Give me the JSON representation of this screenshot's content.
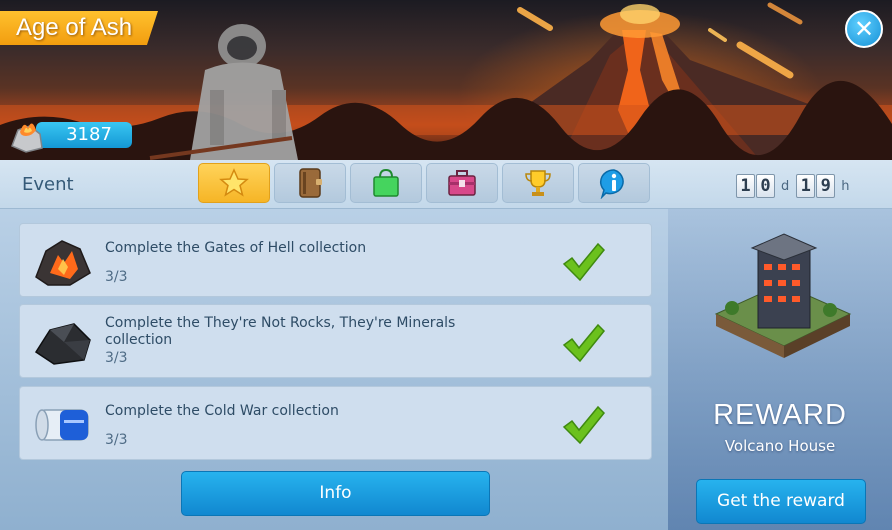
{
  "event": {
    "title": "Age of Ash",
    "currency_value": "3187",
    "close_icon": "close-icon"
  },
  "tabbar": {
    "label": "Event",
    "tabs": [
      {
        "icon": "star-icon",
        "active": true
      },
      {
        "icon": "journal-icon",
        "active": false
      },
      {
        "icon": "shopping-bag-icon",
        "active": false
      },
      {
        "icon": "toolbox-icon",
        "active": false
      },
      {
        "icon": "trophy-icon",
        "active": false
      },
      {
        "icon": "info-icon",
        "active": false
      }
    ]
  },
  "timer": {
    "days_d1": "1",
    "days_d2": "0",
    "days_unit": "d",
    "hours_d1": "1",
    "hours_d2": "9",
    "hours_unit": "h"
  },
  "tasks": [
    {
      "text": "Complete the Gates of Hell collection",
      "progress": "3/3",
      "done": true,
      "icon": "lava-rock-icon"
    },
    {
      "text": "Complete the They're Not Rocks, They're Minerals collection",
      "progress": "3/3",
      "done": true,
      "icon": "black-mineral-icon"
    },
    {
      "text": "Complete the Cold War collection",
      "progress": "3/3",
      "done": true,
      "icon": "canister-icon"
    }
  ],
  "buttons": {
    "info": "Info",
    "get_reward": "Get the reward"
  },
  "reward": {
    "heading": "REWARD",
    "name": "Volcano House",
    "icon": "volcano-house-icon"
  },
  "colors": {
    "accent_orange": "#f6a91a",
    "button_blue": "#1a9ee0",
    "check_green": "#6bc11d"
  }
}
